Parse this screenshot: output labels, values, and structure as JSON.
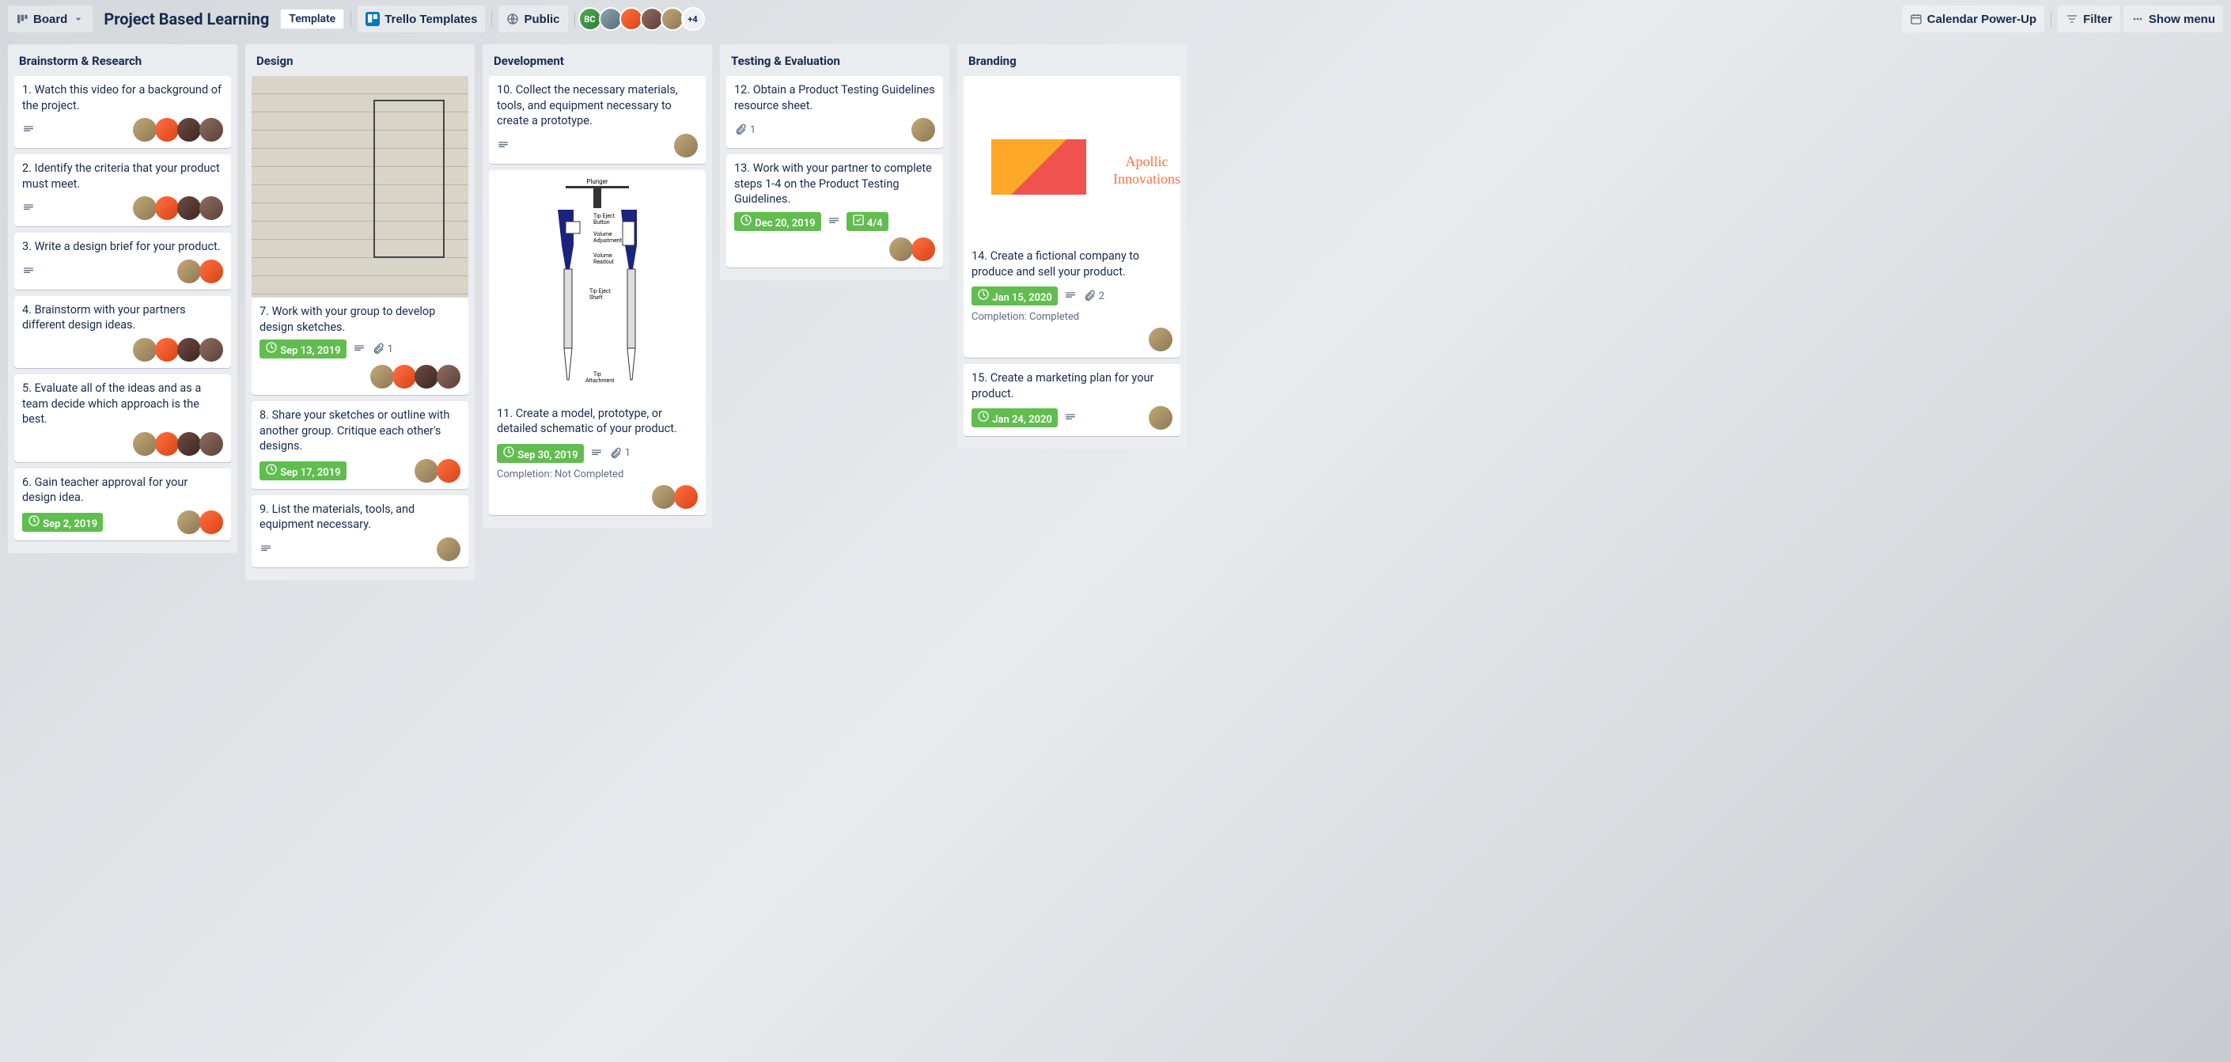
{
  "header": {
    "view_selector": "Board",
    "board_title": "Project Based Learning",
    "template_label": "Template",
    "workspace_label": "Trello Templates",
    "visibility": "Public",
    "member_overflow": "+4",
    "calendar_btn": "Calendar Power-Up",
    "filter_btn": "Filter",
    "show_menu": "Show menu",
    "avatar_bc": "BC"
  },
  "lists": [
    {
      "title": "Brainstorm & Research",
      "cards": [
        {
          "title": "1. Watch this video for a background of the project.",
          "desc": true,
          "members": 4
        },
        {
          "title": "2. Identify the criteria that your product must meet.",
          "desc": true,
          "members": 4
        },
        {
          "title": "3. Write a design brief for your product.",
          "desc": true,
          "members": 2
        },
        {
          "title": "4. Brainstorm with your partners different design ideas.",
          "members": 4
        },
        {
          "title": "5. Evaluate all of the ideas and as a team decide which approach is the best.",
          "members": 4
        },
        {
          "title": "6. Gain teacher approval for your design idea.",
          "due": "Sep 2, 2019",
          "members": 2
        }
      ]
    },
    {
      "title": "Design",
      "cards": [
        {
          "title": "7. Work with your group to develop design sketches.",
          "cover": "sketch",
          "due": "Sep 13, 2019",
          "desc": true,
          "attach": "1",
          "members": 4
        },
        {
          "title": "8. Share your sketches or outline with another group. Critique each other's designs.",
          "due": "Sep 17, 2019",
          "members": 2
        },
        {
          "title": "9. List the materials, tools, and equipment necessary.",
          "desc": true,
          "members": 1
        }
      ]
    },
    {
      "title": "Development",
      "cards": [
        {
          "title": "10. Collect the necessary materials, tools, and equipment necessary to create a prototype.",
          "desc": true,
          "members": 1
        },
        {
          "title": "11. Create a model, prototype, or detailed schematic of your product.",
          "cover": "diagram",
          "due": "Sep 30, 2019",
          "desc": true,
          "attach": "1",
          "completion": "Completion: Not Completed",
          "members": 2
        }
      ]
    },
    {
      "title": "Testing & Evaluation",
      "cards": [
        {
          "title": "12. Obtain a Product Testing Guidelines resource sheet.",
          "attach": "1",
          "members": 1
        },
        {
          "title": "13. Work with your partner to complete steps 1-4 on the Product Testing Guidelines.",
          "due": "Dec 20, 2019",
          "desc": true,
          "checklist": "4/4",
          "members": 2
        }
      ]
    },
    {
      "title": "Branding",
      "cards": [
        {
          "title": "14. Create a fictional company to produce and sell your product.",
          "cover": "logo",
          "logo_name": "Apollic",
          "logo_sub": "Innovations",
          "due": "Jan 15, 2020",
          "desc": true,
          "attach": "2",
          "completion": "Completion: Completed",
          "members": 1
        },
        {
          "title": "15. Create a marketing plan for your product.",
          "due": "Jan 24, 2020",
          "desc": true,
          "members": 1
        }
      ]
    }
  ]
}
